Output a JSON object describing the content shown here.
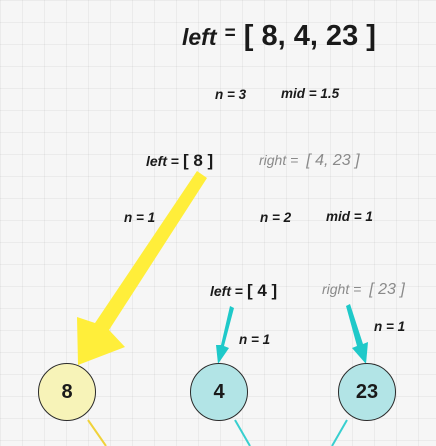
{
  "top": {
    "var": "left",
    "eq": "=",
    "array": "[ 8, 4, 23 ]",
    "n_label": "n = 3",
    "mid_label": "mid = 1.5"
  },
  "level1": {
    "left_var": "left",
    "left_eq": "=",
    "left_array": "[ 8 ]",
    "right_var": "right",
    "right_eq": "=",
    "right_array": "[ 4, 23 ]",
    "left_n": "n = 1",
    "right_n": "n = 2",
    "right_mid": "mid = 1"
  },
  "level2": {
    "left_var": "left",
    "left_eq": "=",
    "left_array": "[ 4 ]",
    "right_var": "right",
    "right_eq": "=",
    "right_array": "[ 23 ]",
    "left_n": "n = 1",
    "right_n": "n = 1"
  },
  "nodes": [
    {
      "value": "8",
      "fill": "#f7f3b8"
    },
    {
      "value": "4",
      "fill": "#b2e4e6"
    },
    {
      "value": "23",
      "fill": "#b2e4e6"
    }
  ],
  "colors": {
    "yellow_arrow": "#ffee3a",
    "teal_arrow": "#1fc9c9",
    "yellow_line": "#f0d23a",
    "teal_line": "#38cfcf"
  }
}
